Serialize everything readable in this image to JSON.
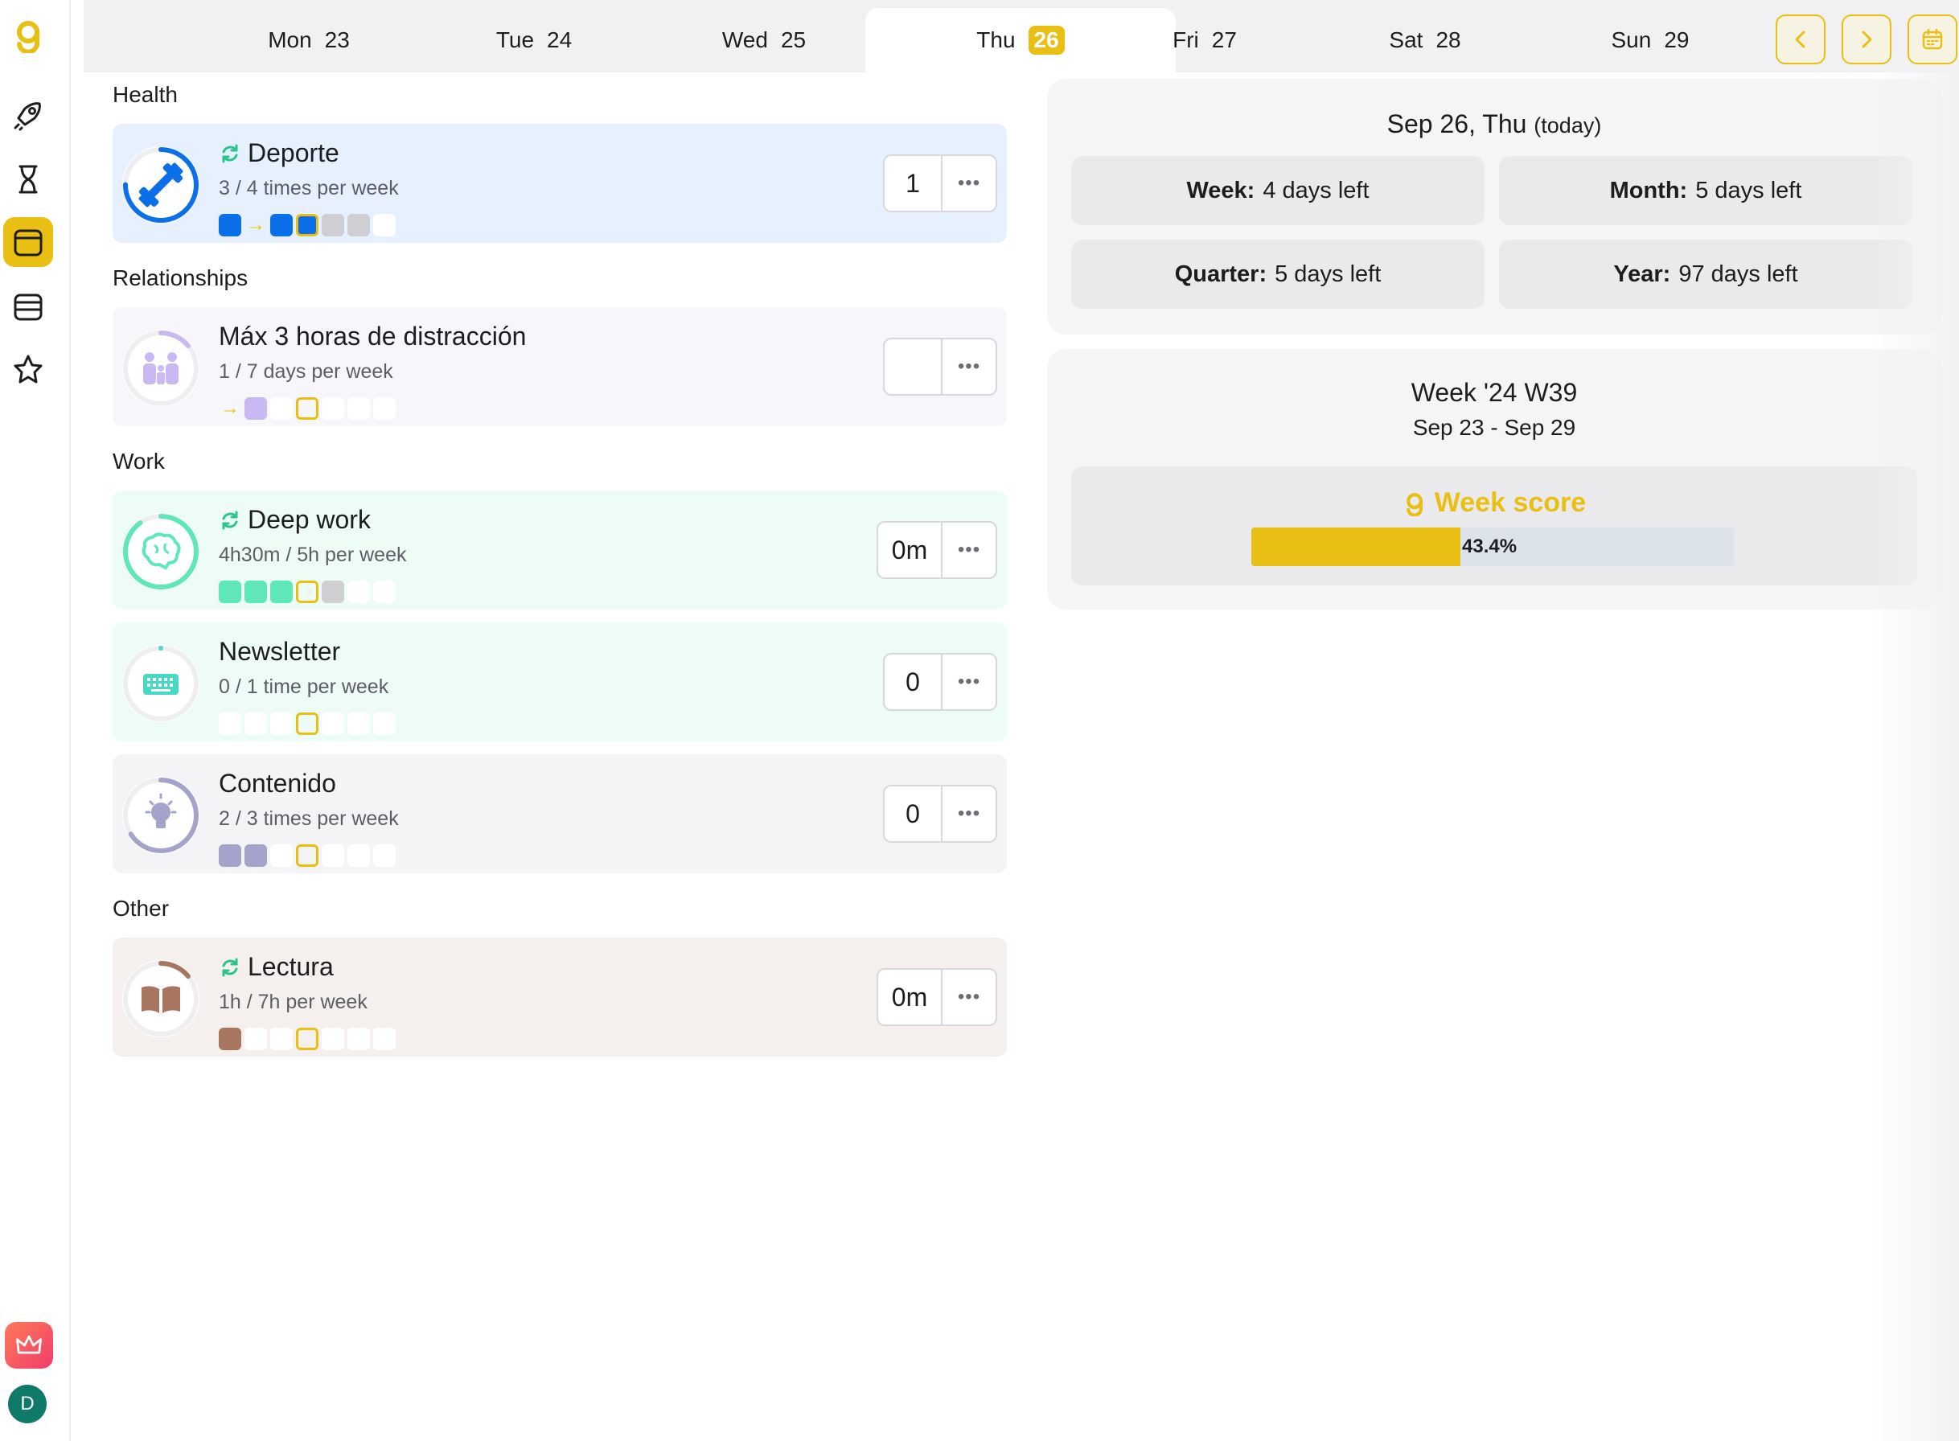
{
  "sidebar": {
    "logo": "logo-g-icon",
    "items": [
      {
        "icon": "rocket-icon",
        "active": false
      },
      {
        "icon": "hourglass-icon",
        "active": false
      },
      {
        "icon": "calendar-day-icon",
        "active": true
      },
      {
        "icon": "calendar-week-icon",
        "active": false
      },
      {
        "icon": "star-icon",
        "active": false
      }
    ],
    "premium_icon": "crown-icon",
    "avatar_initial": "D"
  },
  "week_strip": {
    "days": [
      {
        "name": "Mon",
        "num": "23",
        "active": false
      },
      {
        "name": "Tue",
        "num": "24",
        "active": false
      },
      {
        "name": "Wed",
        "num": "25",
        "active": false
      },
      {
        "name": "Thu",
        "num": "26",
        "active": true
      },
      {
        "name": "Fri",
        "num": "27",
        "active": false
      },
      {
        "name": "Sat",
        "num": "28",
        "active": false
      },
      {
        "name": "Sun",
        "num": "29",
        "active": false
      }
    ]
  },
  "groups": [
    {
      "label": "Health"
    },
    {
      "label": "Relationships"
    },
    {
      "label": "Work"
    },
    {
      "label": "Other"
    }
  ],
  "habits": [
    {
      "title": "Deporte",
      "repeat": true,
      "subtitle": "3 / 4 times per week",
      "value": "1",
      "color": "#0a6fe8",
      "bg": "#e6f0fe",
      "progress": 0.75,
      "icon": "dumbbell-icon",
      "dots": [
        "filled",
        "arrow",
        "filled",
        "today-filled",
        "grey",
        "grey",
        "empty"
      ]
    },
    {
      "title": "Máx 3 horas de distracción",
      "repeat": false,
      "subtitle": "1 / 7 days per week",
      "value": "",
      "color": "#c9b8f2",
      "bg": "#f7f6fa",
      "progress": 0.14,
      "icon": "family-icon",
      "dots": [
        "arrow",
        "filled",
        "empty",
        "today",
        "empty",
        "empty",
        "empty"
      ]
    },
    {
      "title": "Deep work",
      "repeat": true,
      "subtitle": "4h30m / 5h per week",
      "value": "0m",
      "color": "#5ee8b7",
      "bg": "#eefcf6",
      "progress": 0.9,
      "icon": "brain-icon",
      "dots": [
        "filled",
        "filled",
        "filled",
        "today",
        "grey",
        "empty",
        "empty"
      ]
    },
    {
      "title": "Newsletter",
      "repeat": false,
      "subtitle": "0 / 1 time per week",
      "value": "0",
      "color": "#46d9c3",
      "bg": "#eefcf8",
      "progress": 0.0,
      "icon": "keyboard-icon",
      "dots": [
        "empty",
        "empty",
        "empty",
        "today",
        "empty",
        "empty",
        "empty"
      ]
    },
    {
      "title": "Contenido",
      "repeat": false,
      "subtitle": "2 / 3 times per week",
      "value": "0",
      "color": "#a3a3cc",
      "bg": "#f4f4f6",
      "progress": 0.66,
      "icon": "lightbulb-icon",
      "dots": [
        "filled",
        "filled",
        "empty",
        "today",
        "empty",
        "empty",
        "empty"
      ]
    },
    {
      "title": "Lectura",
      "repeat": true,
      "subtitle": "1h / 7h per week",
      "value": "0m",
      "color": "#a87560",
      "bg": "#f5f0ee",
      "progress": 0.14,
      "icon": "book-icon",
      "dots": [
        "filled",
        "empty",
        "empty",
        "today",
        "empty",
        "empty",
        "empty"
      ]
    }
  ],
  "today_panel": {
    "date": "Sep 26, Thu",
    "today_tag": "(today)",
    "stats": [
      {
        "label": "Week:",
        "value": "4 days left"
      },
      {
        "label": "Month:",
        "value": "5 days left"
      },
      {
        "label": "Quarter:",
        "value": "5 days left"
      },
      {
        "label": "Year:",
        "value": "97 days left"
      }
    ]
  },
  "week_panel": {
    "title": "Week '24 W39",
    "range": "Sep 23 - Sep 29",
    "score_label": "Week score",
    "score_text": "43.4%",
    "score_value": 0.434
  },
  "colors": {
    "accent": "#e9bf14",
    "repeat": "#2bc48a"
  }
}
